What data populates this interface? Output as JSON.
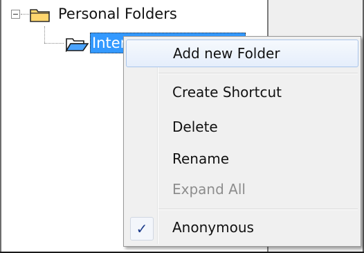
{
  "tree": {
    "root": {
      "label": "Personal Folders",
      "expander": "collapse-minus-icon",
      "icon": "folder-closed-icon"
    },
    "child": {
      "label": "Inter",
      "icon": "folder-open-icon",
      "selected": true
    }
  },
  "context_menu": {
    "items": [
      {
        "label": "Add new Folder",
        "state": "hover"
      },
      {
        "label": "Create Shortcut",
        "state": "normal"
      },
      {
        "label": "Delete",
        "state": "normal"
      },
      {
        "label": "Rename",
        "state": "normal"
      },
      {
        "label": "Expand All",
        "state": "disabled"
      },
      {
        "label": "Anonymous",
        "state": "checked",
        "check_glyph": "✓"
      }
    ]
  },
  "colors": {
    "selection_bg": "#3399ff",
    "menu_bg": "#f0f0f0",
    "hover_border": "#a8c4ea",
    "disabled_text": "#8d8d8d",
    "check": "#1c3b8a",
    "folder": "#ffd66e",
    "folder_open": "#4aa3ff"
  }
}
